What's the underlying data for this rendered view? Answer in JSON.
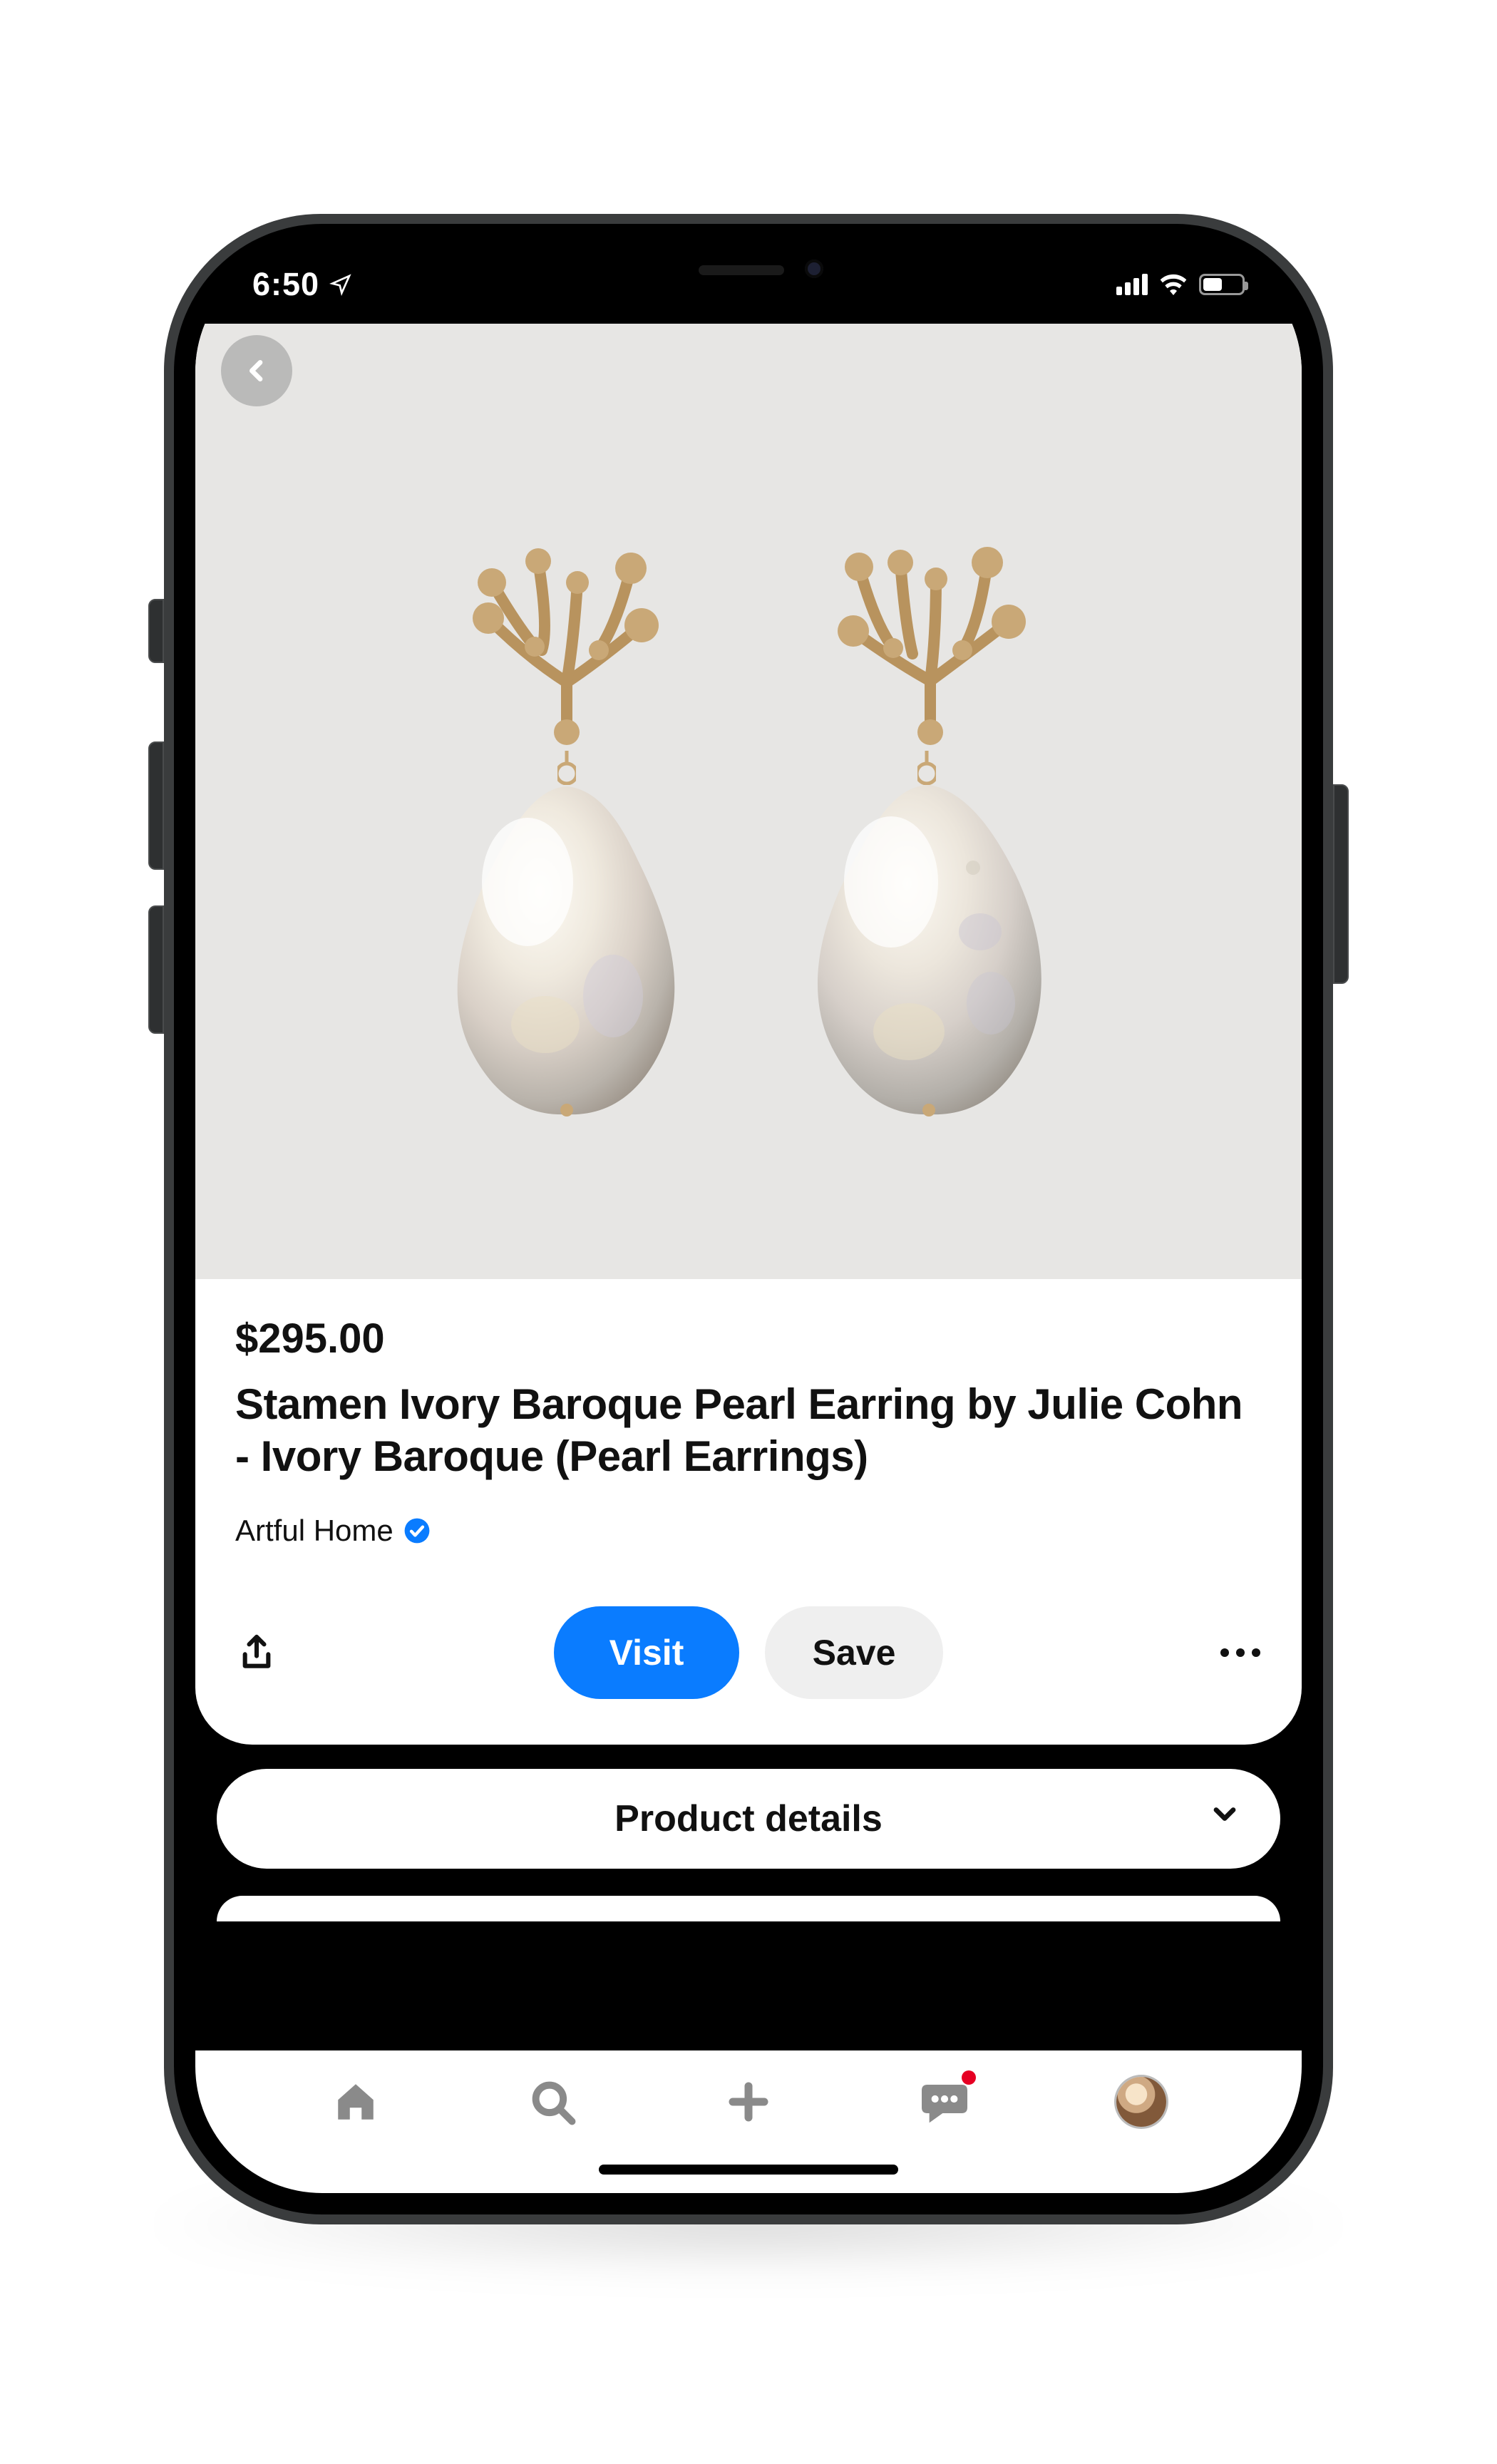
{
  "status": {
    "time": "6:50"
  },
  "product": {
    "price": "$295.00",
    "title": "Stamen Ivory Baroque Pearl Earring by Julie Cohn - Ivory Baroque (Pearl Earrings)",
    "merchant": "Artful Home"
  },
  "actions": {
    "visit_label": "Visit",
    "save_label": "Save"
  },
  "details_bar": {
    "label": "Product details"
  }
}
